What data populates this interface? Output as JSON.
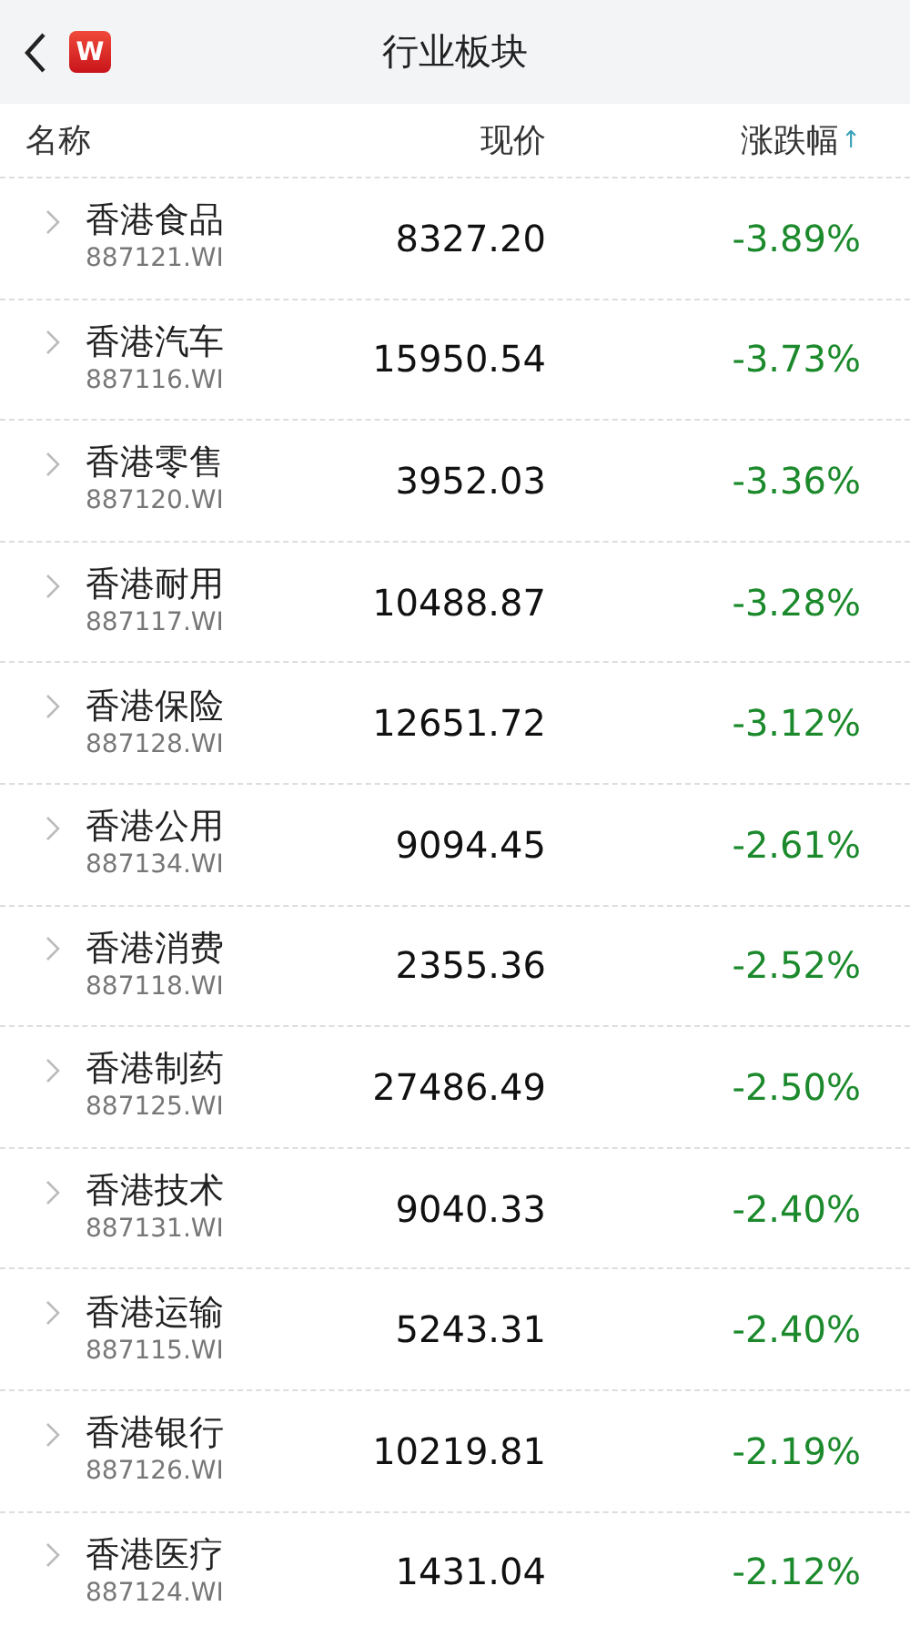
{
  "header": {
    "title": "行业板块",
    "logo_text": "W"
  },
  "columns": [
    {
      "label": "名称"
    },
    {
      "label": "现价"
    },
    {
      "label": "涨跌幅",
      "sort_mark": "↑"
    }
  ],
  "rows": [
    {
      "name": "香港食品",
      "code": "887121.WI",
      "price": "8327.20",
      "change": "-3.89%",
      "color": "#1c8a2c"
    },
    {
      "name": "香港汽车",
      "code": "887116.WI",
      "price": "15950.54",
      "change": "-3.73%",
      "color": "#1c8a2c"
    },
    {
      "name": "香港零售",
      "code": "887120.WI",
      "price": "3952.03",
      "change": "-3.36%",
      "color": "#1c8a2c"
    },
    {
      "name": "香港耐用",
      "code": "887117.WI",
      "price": "10488.87",
      "change": "-3.28%",
      "color": "#1c8a2c"
    },
    {
      "name": "香港保险",
      "code": "887128.WI",
      "price": "12651.72",
      "change": "-3.12%",
      "color": "#1c8a2c"
    },
    {
      "name": "香港公用",
      "code": "887134.WI",
      "price": "9094.45",
      "change": "-2.61%",
      "color": "#1c8a2c"
    },
    {
      "name": "香港消费",
      "code": "887118.WI",
      "price": "2355.36",
      "change": "-2.52%",
      "color": "#1c8a2c"
    },
    {
      "name": "香港制药",
      "code": "887125.WI",
      "price": "27486.49",
      "change": "-2.50%",
      "color": "#1c8a2c"
    },
    {
      "name": "香港技术",
      "code": "887131.WI",
      "price": "9040.33",
      "change": "-2.40%",
      "color": "#1c8a2c"
    },
    {
      "name": "香港运输",
      "code": "887115.WI",
      "price": "5243.31",
      "change": "-2.40%",
      "color": "#1c8a2c"
    },
    {
      "name": "香港银行",
      "code": "887126.WI",
      "price": "10219.81",
      "change": "-2.19%",
      "color": "#1c8a2c"
    },
    {
      "name": "香港医疗",
      "code": "887124.WI",
      "price": "1431.04",
      "change": "-2.12%",
      "color": "#1c8a2c"
    }
  ]
}
